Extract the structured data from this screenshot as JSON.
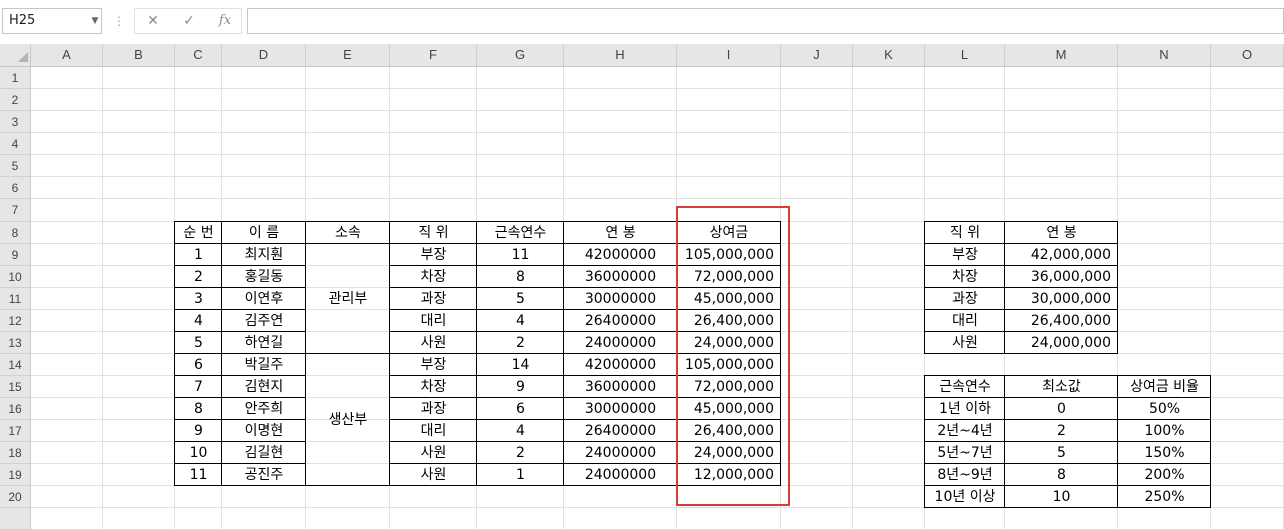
{
  "formula_bar": {
    "name_box": "H25",
    "cancel_icon": "✕",
    "enter_icon": "✓",
    "fx_label": "fx",
    "formula": ""
  },
  "columns": [
    "A",
    "B",
    "C",
    "D",
    "E",
    "F",
    "G",
    "H",
    "I",
    "J",
    "K",
    "L",
    "M",
    "N",
    "O"
  ],
  "rows": [
    "1",
    "2",
    "3",
    "4",
    "5",
    "6",
    "7",
    "8",
    "9",
    "10",
    "11",
    "12",
    "13",
    "14",
    "15",
    "16",
    "17",
    "18",
    "19",
    "20"
  ],
  "main_table": {
    "headers": [
      "순 번",
      "이 름",
      "소속",
      "직 위",
      "근속연수",
      "연 봉",
      "상여금"
    ],
    "departments": [
      "관리부",
      "생산부"
    ],
    "rows": [
      [
        "1",
        "최지훤",
        "부장",
        "11",
        "42000000",
        "105,000,000"
      ],
      [
        "2",
        "홍길동",
        "차장",
        "8",
        "36000000",
        "72,000,000"
      ],
      [
        "3",
        "이연후",
        "과장",
        "5",
        "30000000",
        "45,000,000"
      ],
      [
        "4",
        "김주연",
        "대리",
        "4",
        "26400000",
        "26,400,000"
      ],
      [
        "5",
        "하연길",
        "사원",
        "2",
        "24000000",
        "24,000,000"
      ],
      [
        "6",
        "박길주",
        "부장",
        "14",
        "42000000",
        "105,000,000"
      ],
      [
        "7",
        "김현지",
        "차장",
        "9",
        "36000000",
        "72,000,000"
      ],
      [
        "8",
        "안주희",
        "과장",
        "6",
        "30000000",
        "45,000,000"
      ],
      [
        "9",
        "이명현",
        "대리",
        "4",
        "26400000",
        "26,400,000"
      ],
      [
        "10",
        "김길현",
        "사원",
        "2",
        "24000000",
        "24,000,000"
      ],
      [
        "11",
        "공진주",
        "사원",
        "1",
        "24000000",
        "12,000,000"
      ]
    ]
  },
  "salary_table": {
    "headers": [
      "직 위",
      "연 봉"
    ],
    "rows": [
      [
        "부장",
        "42,000,000"
      ],
      [
        "차장",
        "36,000,000"
      ],
      [
        "과장",
        "30,000,000"
      ],
      [
        "대리",
        "26,400,000"
      ],
      [
        "사원",
        "24,000,000"
      ]
    ]
  },
  "bonus_table": {
    "headers": [
      "근속연수",
      "최소값",
      "상여금 비율"
    ],
    "rows": [
      [
        "1년 이하",
        "0",
        "50%"
      ],
      [
        "2년~4년",
        "2",
        "100%"
      ],
      [
        "5년~7년",
        "5",
        "150%"
      ],
      [
        "8년~9년",
        "8",
        "200%"
      ],
      [
        "10년 이상",
        "10",
        "250%"
      ]
    ]
  },
  "colors": {
    "highlight_border": "#d93b3b",
    "header_bg": "#e6e6e6",
    "gridline": "#e1e1e1"
  }
}
